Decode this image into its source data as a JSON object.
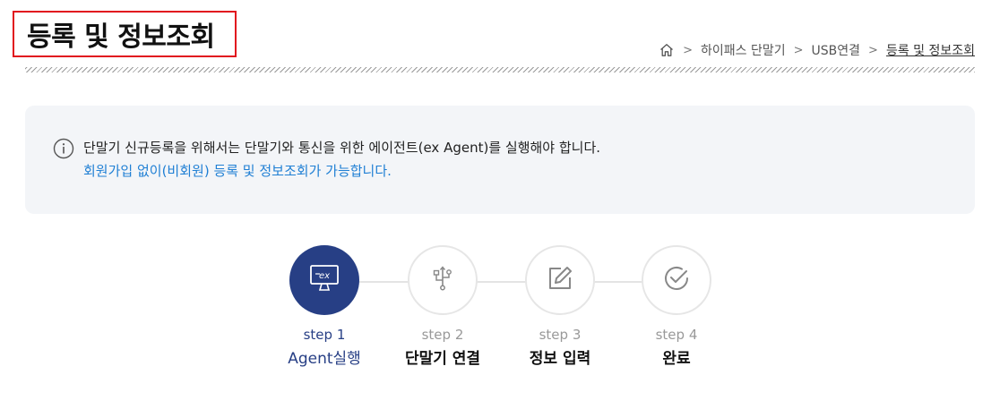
{
  "header": {
    "title": "등록 및 정보조회",
    "breadcrumb": {
      "home_icon": "home-icon",
      "items": [
        "하이패스 단말기",
        "USB연결",
        "등록 및 정보조회"
      ]
    }
  },
  "notice": {
    "icon": "info-icon",
    "line1": "단말기 신규등록을 위해서는 단말기와 통신을 위한 에이전트(ex Agent)를 실행해야 합니다.",
    "line2": "회원가입 없이(비회원) 등록 및 정보조회가 가능합니다.",
    "line2_color": "#1f7fd4"
  },
  "steps": [
    {
      "num": "step 1",
      "label": "Agent실행",
      "icon": "monitor-ex-icon",
      "active": true
    },
    {
      "num": "step 2",
      "label": "단말기 연결",
      "icon": "usb-icon",
      "active": false
    },
    {
      "num": "step 3",
      "label": "정보 입력",
      "icon": "edit-icon",
      "active": false
    },
    {
      "num": "step 4",
      "label": "완료",
      "icon": "check-circle-icon",
      "active": false
    }
  ],
  "colors": {
    "accent": "#273f85",
    "title_box_border": "#e1141e"
  }
}
